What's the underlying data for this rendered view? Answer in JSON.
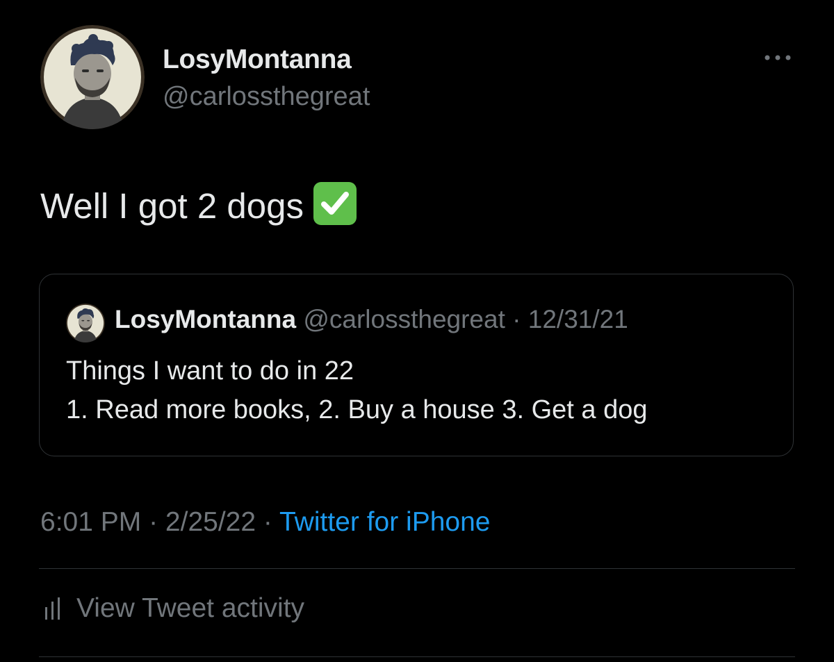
{
  "tweet": {
    "author": {
      "display_name": "LosyMontanna",
      "handle": "@carlossthegreat",
      "avatar_icon": "cartoon-avatar"
    },
    "more_icon": "more-horizontal-icon",
    "text": "Well I got 2 dogs",
    "emoji_icon": "white-check-mark-emoji",
    "quoted_tweet": {
      "display_name": "LosyMontanna",
      "handle": "@carlossthegreat",
      "separator": " · ",
      "date": "12/31/21",
      "lines": [
        "Things I want to do in 22",
        "1. Read more books, 2. Buy a house 3. Get a dog"
      ]
    },
    "meta": {
      "time": "6:01 PM",
      "separator": " · ",
      "date": "2/25/22",
      "source": "Twitter for iPhone"
    },
    "activity": {
      "label": "View Tweet activity",
      "icon": "analytics-bars-icon"
    }
  },
  "colors": {
    "background": "#000000",
    "primary_text": "#e7e9ea",
    "secondary_text": "#71767b",
    "link": "#1d9bf0",
    "border": "#2f3336",
    "check_green": "#5fbf4b"
  }
}
